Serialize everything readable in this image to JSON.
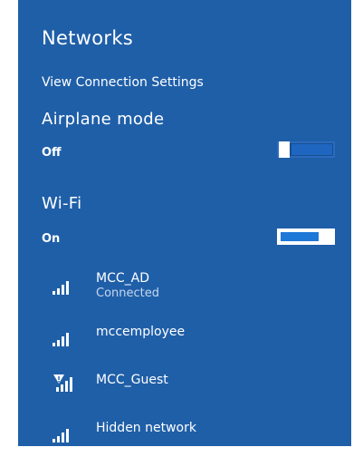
{
  "panel": {
    "title": "Networks",
    "view_settings_link": "View Connection Settings"
  },
  "airplane_mode": {
    "title": "Airplane mode",
    "state_label": "Off",
    "enabled": false
  },
  "wifi": {
    "title": "Wi-Fi",
    "state_label": "On",
    "enabled": true
  },
  "networks": [
    {
      "name": "MCC_AD",
      "status": "Connected",
      "icon": "wifi-signal-icon",
      "secured_warning": false
    },
    {
      "name": "mccemployee",
      "status": "",
      "icon": "wifi-signal-icon",
      "secured_warning": false
    },
    {
      "name": "MCC_Guest",
      "status": "",
      "icon": "wifi-signal-warning-icon",
      "secured_warning": true
    },
    {
      "name": "Hidden network",
      "status": "",
      "icon": "wifi-signal-icon",
      "secured_warning": false
    }
  ],
  "colors": {
    "panel_background": "#1f5fa8",
    "text": "#ffffff",
    "toggle_on_fill": "#1e78d8",
    "status_text": "#c5d7ee"
  }
}
